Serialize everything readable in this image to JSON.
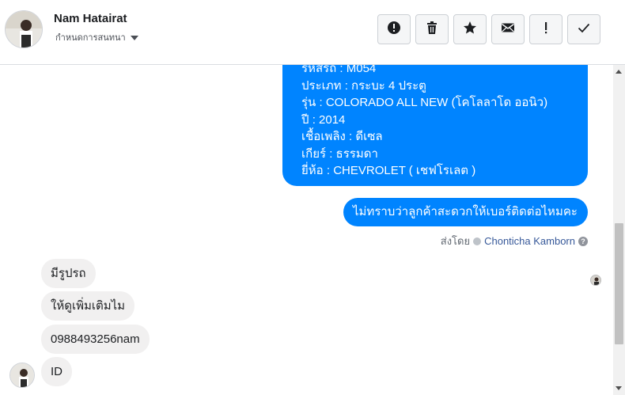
{
  "header": {
    "contact_name": "Nam Hatairat",
    "assign_label": "กำหนดการสนทนา"
  },
  "toolbar": {
    "buttons": [
      {
        "icon": "alert-circle-icon"
      },
      {
        "icon": "trash-icon"
      },
      {
        "icon": "star-icon"
      },
      {
        "icon": "envelope-icon"
      },
      {
        "icon": "exclamation-icon"
      },
      {
        "icon": "checkmark-icon"
      }
    ]
  },
  "thread": {
    "car_details": [
      "รหัสรถ : M054",
      "ประเภท : กระบะ 4 ประตู",
      "รุ่น : COLORADO ALL NEW (โคโลลาโด ออนิว)",
      "ปี : 2014",
      "เชื้อเพลิง : ดีเซล",
      "เกียร์ : ธรรมดา",
      "ยี่ห้อ : CHEVROLET ( เชฟโรเลต )"
    ],
    "outgoing_question": "ไม่ทราบว่าลูกค้าสะดวกให้เบอร์ติดต่อไหมคะ",
    "sent_by_label": "ส่งโดย",
    "sent_by_agent": "Chonticha Kamborn",
    "help_glyph": "?",
    "incoming": [
      "มีรูปรถ",
      "ให้ดูเพิ่มเติมไม",
      "0988493256nam",
      "ID"
    ]
  },
  "colors": {
    "outgoing_bubble": "#0084ff",
    "incoming_bubble": "#f1f0f0",
    "agent_link": "#365899"
  }
}
